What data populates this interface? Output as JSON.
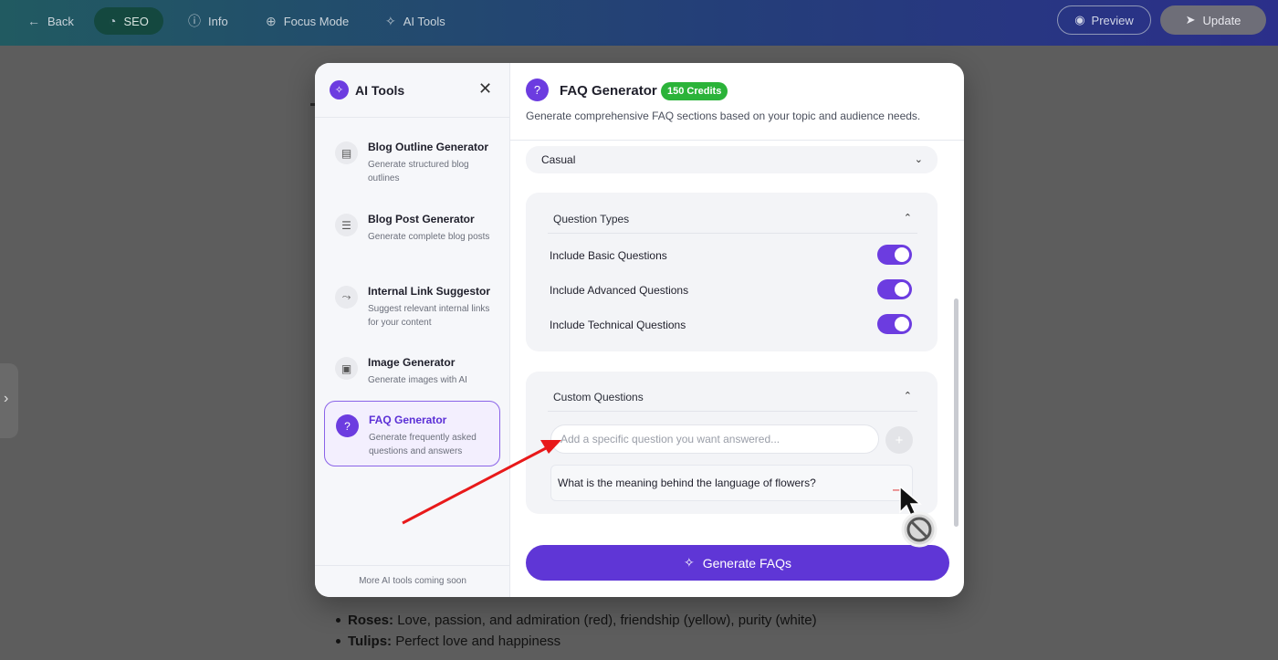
{
  "topbar": {
    "back": "Back",
    "seo": "SEO",
    "info": "Info",
    "focus_mode": "Focus Mode",
    "ai_tools": "AI Tools",
    "preview": "Preview",
    "update": "Update"
  },
  "background": {
    "list": [
      {
        "bold": "Roses:",
        "text": " Love, passion, and admiration (red), friendship (yellow), purity (white)"
      },
      {
        "bold": "Tulips:",
        "text": " Perfect love and happiness"
      }
    ]
  },
  "modal": {
    "sidebar": {
      "title": "AI Tools",
      "tools": [
        {
          "name": "Blog Outline Generator",
          "desc": "Generate structured blog outlines",
          "icon": "document-icon",
          "glyph": "▤"
        },
        {
          "name": "Blog Post Generator",
          "desc": "Generate complete blog posts",
          "icon": "article-icon",
          "glyph": "☰"
        },
        {
          "name": "Internal Link Suggestor",
          "desc": "Suggest relevant internal links for your content",
          "icon": "link-route-icon",
          "glyph": "⤳"
        },
        {
          "name": "Image Generator",
          "desc": "Generate images with AI",
          "icon": "image-sparkle-icon",
          "glyph": "▣"
        },
        {
          "name": "FAQ Generator",
          "desc": "Generate frequently asked questions and answers",
          "icon": "question-icon",
          "glyph": "?"
        }
      ],
      "footer": "More AI tools coming soon"
    },
    "main": {
      "title": "FAQ Generator",
      "credits": "150 Credits",
      "subtitle": "Generate comprehensive FAQ sections based on your topic and audience needs.",
      "tone_value": "Casual",
      "question_types": {
        "title": "Question Types",
        "options": [
          {
            "label": "Include Basic Questions",
            "on": true
          },
          {
            "label": "Include Advanced Questions",
            "on": true
          },
          {
            "label": "Include Technical Questions",
            "on": true
          }
        ]
      },
      "custom_questions": {
        "title": "Custom Questions",
        "placeholder": "Add a specific question you want answered...",
        "items": [
          "What is the meaning behind the language of flowers?"
        ],
        "remove_glyph": "—"
      },
      "generate_button": "Generate FAQs"
    }
  },
  "colors": {
    "accent": "#5f36d6",
    "credits_badge": "#2bb339",
    "annotation_arrow": "#e8191a"
  }
}
